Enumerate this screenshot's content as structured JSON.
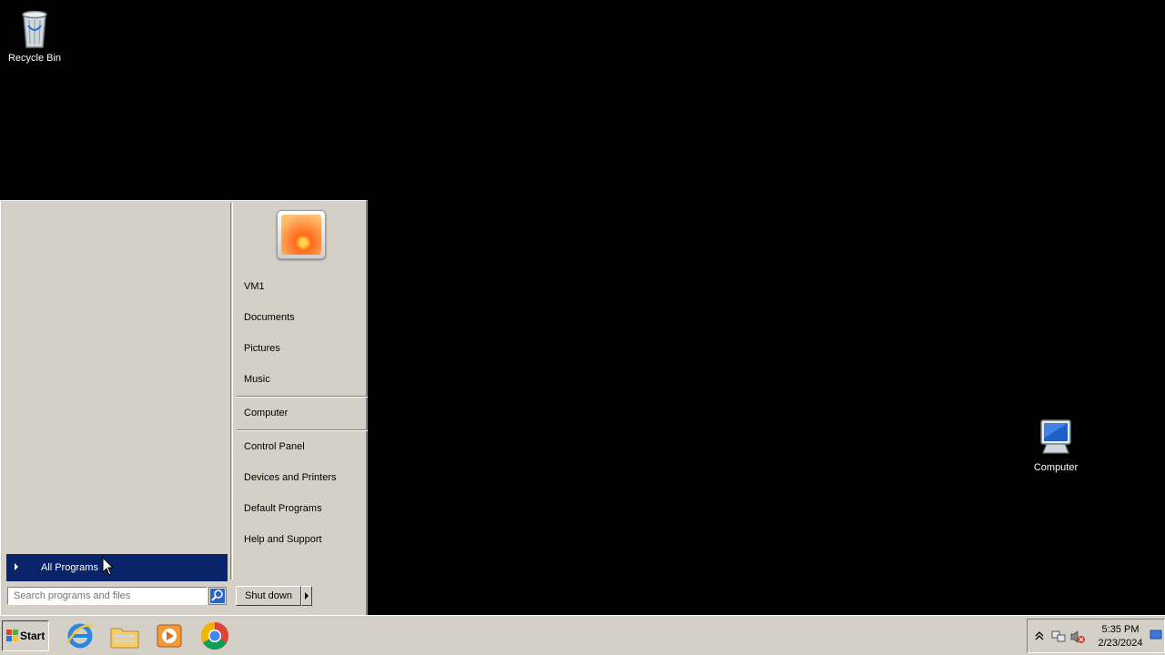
{
  "desktop": {
    "icons": [
      {
        "label": "Recycle Bin",
        "icon": "recycle-bin-icon"
      },
      {
        "label": "Computer",
        "icon": "computer-icon"
      }
    ]
  },
  "start_menu": {
    "right_items": {
      "user": "VM1",
      "documents": "Documents",
      "pictures": "Pictures",
      "music": "Music",
      "computer": "Computer",
      "control_panel": "Control Panel",
      "devices_printers": "Devices and Printers",
      "default_programs": "Default Programs",
      "help_support": "Help and Support"
    },
    "all_programs": "All Programs",
    "search_placeholder": "Search programs and files",
    "shutdown_label": "Shut down",
    "highlight_color": "#0a246a"
  },
  "taskbar": {
    "start_label": "Start",
    "pinned": [
      "internet-explorer-icon",
      "windows-explorer-icon",
      "media-player-icon",
      "chrome-icon"
    ],
    "clock_time": "5:35 PM",
    "clock_date": "2/23/2024"
  }
}
